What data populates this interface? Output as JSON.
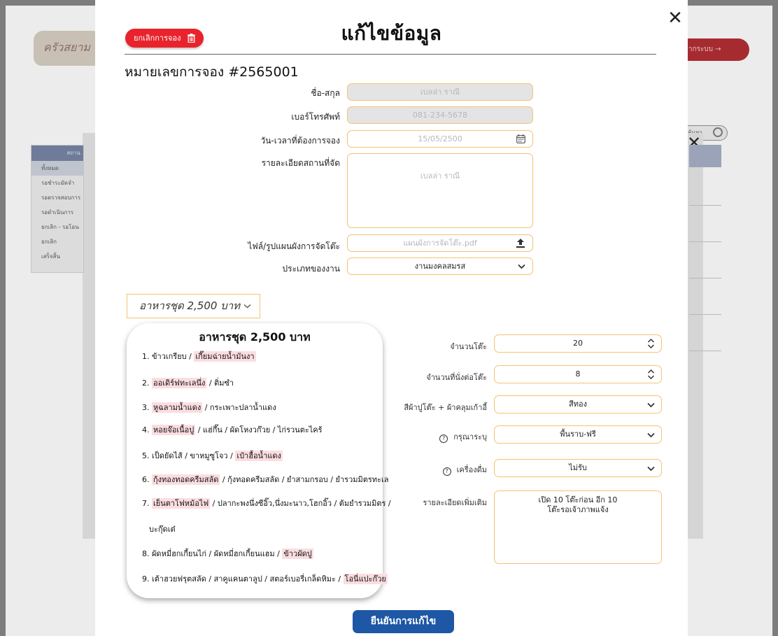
{
  "background": {
    "logo_text": "ครัวสยาม",
    "logout_label": "จากระบบ →",
    "search_placeholder": "ค้นหา",
    "sidebar_header": "สถาน",
    "sidebar_items": [
      "ทั้งหมด",
      "รอชำระมัดจำ",
      "รอตรวจสอบการ",
      "รอดำเนินการ",
      "ยกเลิก - รอโอน",
      "ยกเลิก",
      "เสร็จสิ้น"
    ]
  },
  "modal": {
    "title": "แก้ไขข้อมูล",
    "cancel_booking_label": "ยกเลิกการจอง",
    "booking_number": "หมายเลขการจอง #2565001",
    "confirm_label": "ยืนยันการแก้ไข"
  },
  "form": {
    "name_label": "ชื่อ-สกุล",
    "name_value": "เบลล่า ราณี",
    "phone_label": "เบอร์โทรศัพท์",
    "phone_value": "081-234-5678",
    "datetime_label": "วัน-เวลาที่ต้องการจอง",
    "datetime_value": "15/05/2500",
    "venue_label": "รายละเอียดสถานที่จัด",
    "venue_value": "เบลล่า ราณี",
    "file_label": "ไฟล์/รูปแผนผังการจัดโต๊ะ",
    "file_value": "แผนผังการจัดโต๊ะ.pdf",
    "event_type_label": "ประเภทของงาน",
    "event_type_value": "งานมงคลสมรส"
  },
  "set_menu": {
    "selected": "อาหารชุด 2,500 บาท",
    "card_title": "อาหารชุด 2,500 บาท",
    "items": [
      {
        "parts": [
          {
            "t": "1. ข้าวเกรียบ / ",
            "h": false
          },
          {
            "t": "เกี๊ยมฉ่ายน้ำมันงา",
            "h": true
          }
        ]
      },
      {
        "parts": [
          {
            "t": "2. ",
            "h": false
          },
          {
            "t": "ออเดิร์ฟทะเลนึ่ง",
            "h": true
          },
          {
            "t": " / ติ่มซำ",
            "h": false
          }
        ]
      },
      {
        "parts": [
          {
            "t": "3. ",
            "h": false
          },
          {
            "t": "หูฉลามน้ำแดง",
            "h": true
          },
          {
            "t": " / กระเพาะปลาน้ำแดง",
            "h": false
          }
        ]
      },
      {
        "parts": [
          {
            "t": "4. ",
            "h": false
          },
          {
            "t": "หอยจ๊อเนื้อปู",
            "h": true
          },
          {
            "t": " / แฮ่กึ๊น / ผัดโหงวก๊วย / ไก่รวนตะไคร้",
            "h": false
          }
        ]
      },
      {
        "parts": [
          {
            "t": "5. เป็ดยัดไส้ / ขาหมูซูโจว / ",
            "h": false
          },
          {
            "t": "เป๋าฮื้อน้ำแดง",
            "h": true
          }
        ]
      },
      {
        "parts": [
          {
            "t": "6. ",
            "h": false
          },
          {
            "t": "กุ้งทองทอดครีมสลัด",
            "h": true
          },
          {
            "t": " / กุ้งทอดครีมสลัด / ยำสามกรอบ / ยำรวมมิตรทะเล",
            "h": false
          }
        ]
      },
      {
        "parts": [
          {
            "t": "7. ",
            "h": false
          },
          {
            "t": "เย็นตาโฟหม้อไฟ",
            "h": true
          },
          {
            "t": " / ปลากะพงนึ่งซีอิ๊ว,นึ่งมะนาว,โฮกอิ๊ว / ต้มยำรวมมิตร /",
            "h": false
          }
        ]
      },
      {
        "parts": [
          {
            "t": "บะกุ๊ดเต๋",
            "h": false
          }
        ]
      },
      {
        "parts": [
          {
            "t": "8. ผัดหมี่ฮกเกี้ยนไก่ / ผัดหมี่ฮกเกี้ยนแฮม / ",
            "h": false
          },
          {
            "t": "ข้าวผัดปู",
            "h": true
          }
        ]
      },
      {
        "parts": [
          {
            "t": "9. เต้าฮวยฟรุตสลัด / สาคูแคนตาลูป / สตอร์เบอรี่เกล็ดหิมะ / ",
            "h": false
          },
          {
            "t": "โอนี่แปะก๊วย",
            "h": true
          }
        ]
      }
    ]
  },
  "details": {
    "tables_label": "จำนวนโต๊ะ",
    "tables_value": "20",
    "seats_label": "จำนวนที่นั่งต่อโต๊ะ",
    "seats_value": "8",
    "cloth_label": "สีผ้าปูโต๊ะ + ผ้าคลุมเก้าอี้",
    "cloth_value": "สีทอง",
    "floor_label": "กรุณาระบุ",
    "floor_value": "พื้นราบ-ฟรี",
    "drinks_label": "เครื่องดื่ม",
    "drinks_value": "ไม่รับ",
    "notes_label": "รายละเอียดเพิ่มเติม",
    "notes_value_line1": "เปิด 10 โต๊ะก่อน อีก 10",
    "notes_value_line2": "โต๊ะรอเจ้าภาพแจ้ง"
  },
  "colors": {
    "accent_orange": "#f5c274",
    "cancel_red": "#e8232c",
    "confirm_blue": "#1d57a5",
    "highlight_pink": "#fbdde0"
  }
}
